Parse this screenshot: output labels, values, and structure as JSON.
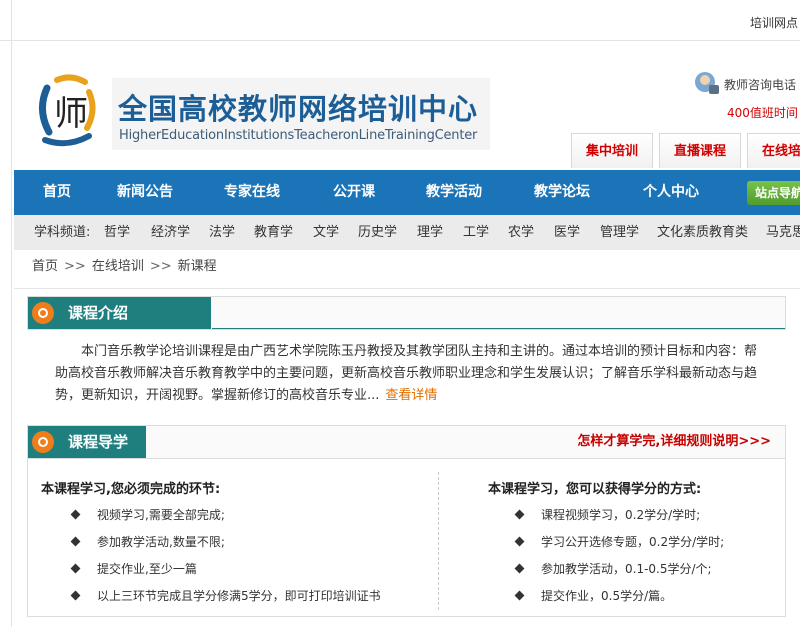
{
  "topbar": {
    "link": "培训网点"
  },
  "logo": {
    "title_cn": "全国高校教师网络培训中心",
    "title_en": "HigherEducationInstitutionsTeacheronLineTrainingCenter",
    "mark_text": "师"
  },
  "consult": {
    "label": "教师咨询电话",
    "hours": "400值班时间"
  },
  "header_tabs": [
    "集中培训",
    "直播课程",
    "在线培训"
  ],
  "nav": {
    "items": [
      "首页",
      "新闻公告",
      "专家在线",
      "公开课",
      "教学活动",
      "教学论坛",
      "个人中心"
    ],
    "guide_button": "站点导航"
  },
  "subjects": {
    "label": "学科频道:",
    "items": [
      "哲学",
      "经济学",
      "法学",
      "教育学",
      "文学",
      "历史学",
      "理学",
      "工学",
      "农学",
      "医学",
      "管理学",
      "文化素质教育类",
      "马克思"
    ]
  },
  "breadcrumb": {
    "home": "首页",
    "sep": ">>",
    "level1": "在线培训",
    "current": "新课程"
  },
  "intro_section": {
    "title": "课程介绍",
    "text": "本门音乐教学论培训课程是由广西艺术学院陈玉丹教授及其教学团队主持和主讲的。通过本培训的预计目标和内容：帮助高校音乐教师解决音乐教育教学中的主要问题，更新高校音乐教师职业理念和学生发展认识；了解音乐学科最新动态与趋势，更新知识，开阔视野。掌握新修订的高校音乐专业...",
    "more_link": "查看详情"
  },
  "guide_section": {
    "title": "课程导学",
    "right_link": "怎样才算学完,详细规则说明>>>",
    "left": {
      "title": "本课程学习,您必须完成的环节:",
      "items": [
        "视频学习,需要全部完成;",
        "参加教学活动,数量不限;",
        "提交作业,至少一篇",
        "以上三环节完成且学分修满5学分，即可打印培训证书"
      ]
    },
    "right": {
      "title": "本课程学习，您可以获得学分的方式:",
      "items": [
        "课程视频学习，0.2学分/学时;",
        "学习公开选修专题，0.2学分/学时;",
        "参加教学活动，0.1-0.5学分/个;",
        "提交作业，0.5学分/篇。"
      ]
    }
  },
  "colors": {
    "nav_blue": "#1a74b7",
    "teal": "#1f7f7f",
    "orange": "#ef7d1a",
    "red": "#d20000",
    "green": "#5aa833"
  }
}
